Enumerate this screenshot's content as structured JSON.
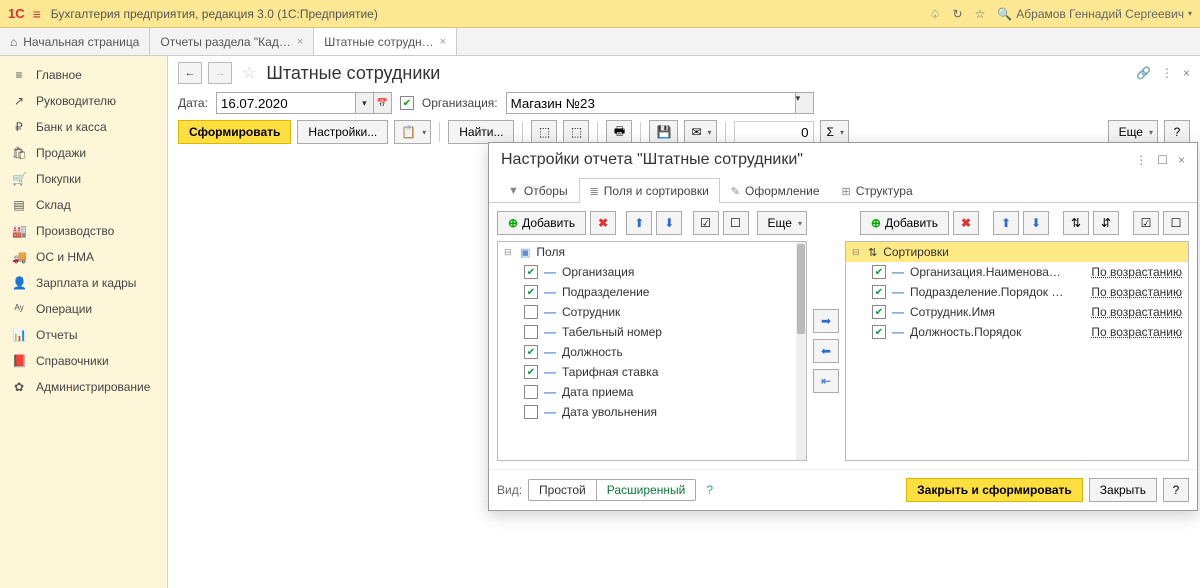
{
  "app": {
    "title": "Бухгалтерия предприятия, редакция 3.0  (1С:Предприятие)",
    "user": "Абрамов Геннадий Сергеевич"
  },
  "tabs": {
    "home": "Начальная страница",
    "t1": "Отчеты раздела \"Кад…",
    "t2": "Штатные сотрудн…"
  },
  "sidebar": [
    {
      "icon": "≡",
      "label": "Главное"
    },
    {
      "icon": "↗",
      "label": "Руководителю"
    },
    {
      "icon": "₽",
      "label": "Банк и касса"
    },
    {
      "icon": "🛍",
      "label": "Продажи"
    },
    {
      "icon": "🛒",
      "label": "Покупки"
    },
    {
      "icon": "▤",
      "label": "Склад"
    },
    {
      "icon": "🏭",
      "label": "Производство"
    },
    {
      "icon": "🚚",
      "label": "ОС и НМА"
    },
    {
      "icon": "👤",
      "label": "Зарплата и кадры"
    },
    {
      "icon": "ᴬʸ",
      "label": "Операции"
    },
    {
      "icon": "📊",
      "label": "Отчеты"
    },
    {
      "icon": "📕",
      "label": "Справочники"
    },
    {
      "icon": "✿",
      "label": "Администрирование"
    }
  ],
  "page": {
    "title": "Штатные сотрудники",
    "date_label": "Дата:",
    "date_value": "16.07.2020",
    "org_label": "Организация:",
    "org_value": "Магазин №23",
    "generate": "Сформировать",
    "settings": "Настройки...",
    "find": "Найти...",
    "more": "Еще",
    "sum_value": "0"
  },
  "dialog": {
    "title": "Настройки отчета \"Штатные сотрудники\"",
    "tabs": {
      "filters": "Отборы",
      "fields": "Поля и сортировки",
      "design": "Оформление",
      "structure": "Структура"
    },
    "add": "Добавить",
    "more": "Еще",
    "fields_header": "Поля",
    "sorts_header": "Сортировки",
    "fields": [
      {
        "checked": true,
        "label": "Организация"
      },
      {
        "checked": true,
        "label": "Подразделение"
      },
      {
        "checked": false,
        "label": "Сотрудник"
      },
      {
        "checked": false,
        "label": "Табельный номер"
      },
      {
        "checked": true,
        "label": "Должность"
      },
      {
        "checked": true,
        "label": "Тарифная ставка"
      },
      {
        "checked": false,
        "label": "Дата приема"
      },
      {
        "checked": false,
        "label": "Дата увольнения"
      }
    ],
    "sorts": [
      {
        "checked": true,
        "label": "Организация.Наименова…",
        "dir": "По возрастанию"
      },
      {
        "checked": true,
        "label": "Подразделение.Порядок …",
        "dir": "По возрастанию"
      },
      {
        "checked": true,
        "label": "Сотрудник.Имя",
        "dir": "По возрастанию"
      },
      {
        "checked": true,
        "label": "Должность.Порядок",
        "dir": "По возрастанию"
      }
    ],
    "view_label": "Вид:",
    "view_simple": "Простой",
    "view_advanced": "Расширенный",
    "close_generate": "Закрыть и сформировать",
    "close": "Закрыть"
  }
}
